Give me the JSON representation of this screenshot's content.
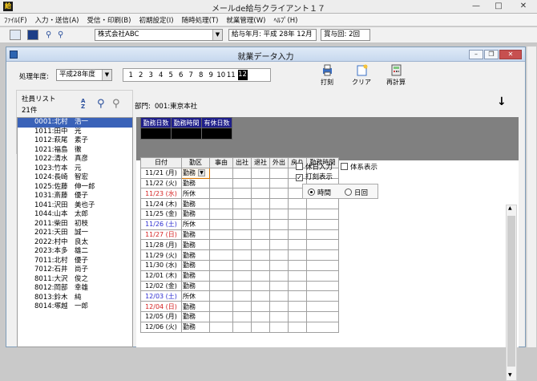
{
  "window": {
    "title": "メールde給与クライアント１７",
    "app_icon": "給"
  },
  "menus": [
    "ﾌｧｲﾙ(F)",
    "入力・送信(A)",
    "受信・印刷(B)",
    "初期設定(I)",
    "随時処理(T)",
    "就業管理(W)",
    "ﾍﾙﾌﾟ(H)"
  ],
  "toolbar": {
    "company": "株式会社ABC",
    "pay_period_label": "給与年月:",
    "pay_period_value": "平成 28年 12月",
    "bonus_label": "賞与回:",
    "bonus_value": "2回"
  },
  "child": {
    "title": "就業データ入力"
  },
  "controls": {
    "year_label": "処理年度:",
    "year_value": "平成28年度",
    "months": [
      "1",
      "2",
      "3",
      "4",
      "5",
      "6",
      "7",
      "8",
      "9",
      "10",
      "11",
      "12"
    ],
    "selected_month": "12",
    "print_label": "打刻",
    "clear_label": "クリア",
    "recalc_label": "再計算"
  },
  "employees": {
    "title": "社員リスト",
    "count": "21件",
    "items": [
      "0001:北村　浩一",
      "1011:田中　光",
      "1012:萩尾　素子",
      "1021:福島　徹",
      "1022:清水　真彦",
      "1023:竹本　元",
      "1024:長崎　智宏",
      "1025:佐藤　伸一郎",
      "1031:斎藤　優子",
      "1041:沢田　美也子",
      "1044:山本　太郎",
      "2011:柴田　初枝",
      "2021:天田　誠一",
      "2022:村中　良太",
      "2023:本多　雄二",
      "7011:北村　優子",
      "7012:石井　尚子",
      "8011:大沢　俊之",
      "8012:岡部　幸雄",
      "8013:鈴木　純",
      "8014:塚越　一郎"
    ],
    "selected": 0
  },
  "department": {
    "label": "部門:",
    "value": "001:東京本社"
  },
  "summary": {
    "headers": [
      "勤務日数",
      "勤務時間",
      "有休日数"
    ],
    "values": [
      "",
      "",
      ""
    ]
  },
  "options": {
    "holiday_input": "休日入力",
    "system_display": "体系表示",
    "print_display": "打刻表示",
    "time_label": "時間",
    "count_label": "日回",
    "holiday_checked": false,
    "system_checked": false,
    "print_checked": true,
    "selected_unit": "時間"
  },
  "grid": {
    "headers": [
      "日付",
      "勤区",
      "事由",
      "出社",
      "退社",
      "外出",
      "戻り",
      "勤務時間"
    ],
    "rows": [
      {
        "date": "11/21 (月)",
        "kin": "勤務",
        "day": "w"
      },
      {
        "date": "11/22 (火)",
        "kin": "勤務",
        "day": "w"
      },
      {
        "date": "11/23 (水)",
        "kin": "所休",
        "day": "h"
      },
      {
        "date": "11/24 (木)",
        "kin": "勤務",
        "day": "w"
      },
      {
        "date": "11/25 (金)",
        "kin": "勤務",
        "day": "w"
      },
      {
        "date": "11/26 (土)",
        "kin": "所休",
        "day": "s"
      },
      {
        "date": "11/27 (日)",
        "kin": "勤務",
        "day": "h"
      },
      {
        "date": "11/28 (月)",
        "kin": "勤務",
        "day": "w"
      },
      {
        "date": "11/29 (火)",
        "kin": "勤務",
        "day": "w"
      },
      {
        "date": "11/30 (水)",
        "kin": "勤務",
        "day": "w"
      },
      {
        "date": "12/01 (木)",
        "kin": "勤務",
        "day": "w"
      },
      {
        "date": "12/02 (金)",
        "kin": "勤務",
        "day": "w"
      },
      {
        "date": "12/03 (土)",
        "kin": "所休",
        "day": "s"
      },
      {
        "date": "12/04 (日)",
        "kin": "勤務",
        "day": "h"
      },
      {
        "date": "12/05 (月)",
        "kin": "勤務",
        "day": "w"
      },
      {
        "date": "12/06 (火)",
        "kin": "勤務",
        "day": "w"
      }
    ]
  },
  "colors": {
    "selection": "#3a62b8",
    "summary_header": "#1f1f8a",
    "saturday": "#2b2bd0",
    "holiday": "#d42020"
  }
}
